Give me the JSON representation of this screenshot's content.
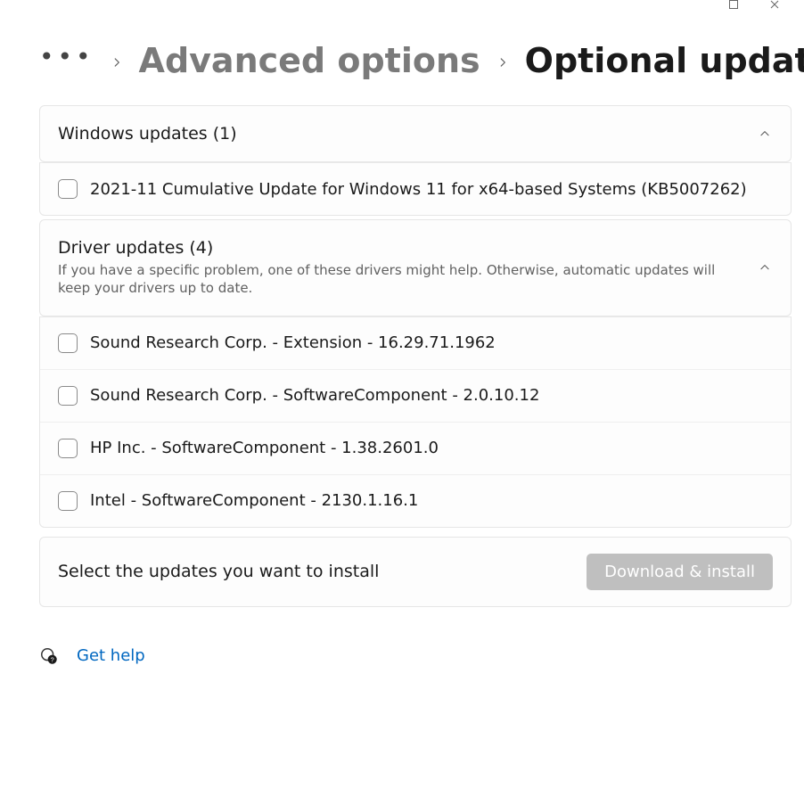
{
  "breadcrumb": {
    "previous": "Advanced options",
    "current": "Optional updates"
  },
  "sections": {
    "windows": {
      "title": "Windows updates (1)",
      "items": [
        {
          "label": "2021-11 Cumulative Update for Windows 11 for x64-based Systems (KB5007262)"
        }
      ]
    },
    "drivers": {
      "title": "Driver updates (4)",
      "subtitle": "If you have a specific problem, one of these drivers might help. Otherwise, automatic updates will keep your drivers up to date.",
      "items": [
        {
          "label": "Sound Research Corp. - Extension - 16.29.71.1962"
        },
        {
          "label": "Sound Research Corp. - SoftwareComponent - 2.0.10.12"
        },
        {
          "label": "HP Inc. - SoftwareComponent - 1.38.2601.0"
        },
        {
          "label": "Intel - SoftwareComponent - 2130.1.16.1"
        }
      ]
    }
  },
  "footer": {
    "prompt": "Select the updates you want to install",
    "button": "Download & install"
  },
  "help": {
    "label": "Get help"
  }
}
